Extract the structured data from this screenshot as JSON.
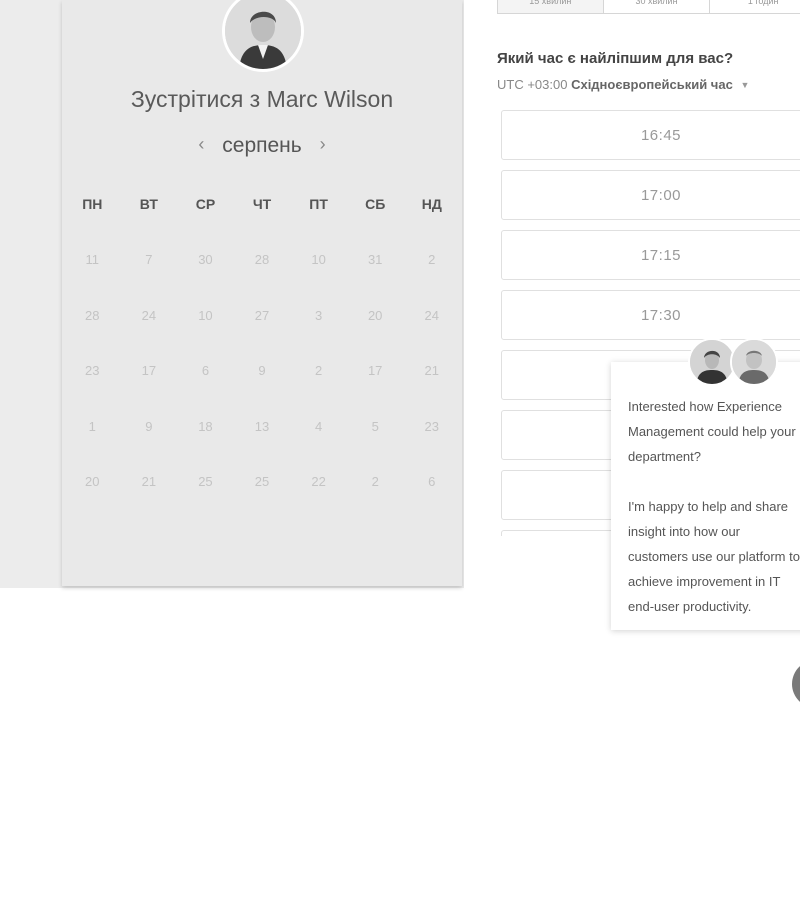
{
  "calendar": {
    "title": "Зустрітися з Marc Wilson",
    "month": "серпень",
    "weekdays": [
      "ПН",
      "ВТ",
      "СР",
      "ЧТ",
      "ПТ",
      "СБ",
      "НД"
    ],
    "weeks": [
      [
        "11",
        "7",
        "30",
        "28",
        "10",
        "31",
        "2"
      ],
      [
        "28",
        "24",
        "10",
        "27",
        "3",
        "20",
        "24"
      ],
      [
        "23",
        "17",
        "6",
        "9",
        "2",
        "17",
        "21"
      ],
      [
        "1",
        "9",
        "18",
        "13",
        "4",
        "5",
        "23"
      ],
      [
        "20",
        "21",
        "25",
        "25",
        "22",
        "2",
        "6"
      ]
    ]
  },
  "booking": {
    "durations": [
      "15 хвилин",
      "30 хвилин",
      "1 годин"
    ],
    "question": "Який час є найліпшим для вас?",
    "timezone_offset": "UTC +03:00",
    "timezone_name": "Східноєвропейський час",
    "slots": [
      "16:45",
      "17:00",
      "17:15",
      "17:30",
      "",
      "",
      "",
      ""
    ]
  },
  "chat": {
    "message": "Interested how Experience Management could help your department?\n\nI'm happy to help and share insight into how our customers use our platform to achieve improvement in IT end-user productivity."
  }
}
